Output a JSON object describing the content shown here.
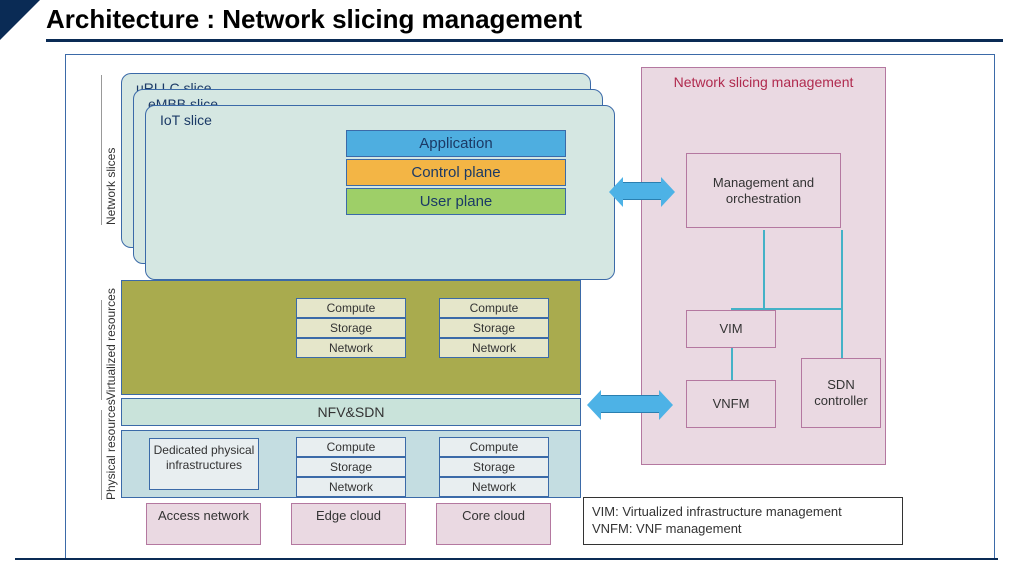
{
  "title": "Architecture : Network slicing management",
  "side_labels": {
    "network_slices": "Network slices",
    "virtualized_resources": "Virtualized resources",
    "physical_resources": "Physical resources"
  },
  "slices": {
    "urllc": "uRLLC slice",
    "embb": "eMBB slice",
    "iot": "IoT slice"
  },
  "planes": {
    "application": "Application",
    "control": "Control plane",
    "user": "User plane"
  },
  "resource_cells": {
    "compute": "Compute",
    "storage": "Storage",
    "network": "Network"
  },
  "nfv_sdn": "NFV&SDN",
  "dedicated": "Dedicated physical infrastructures",
  "columns": {
    "access": "Access network",
    "edge": "Edge cloud",
    "core": "Core cloud"
  },
  "mgmt": {
    "title": "Network slicing management",
    "mano": "Management and orchestration",
    "vim": "VIM",
    "vnfm": "VNFM",
    "sdn": "SDN controller"
  },
  "legend": {
    "line1": "VIM: Virtualized infrastructure management",
    "line2": "VNFM: VNF management"
  }
}
